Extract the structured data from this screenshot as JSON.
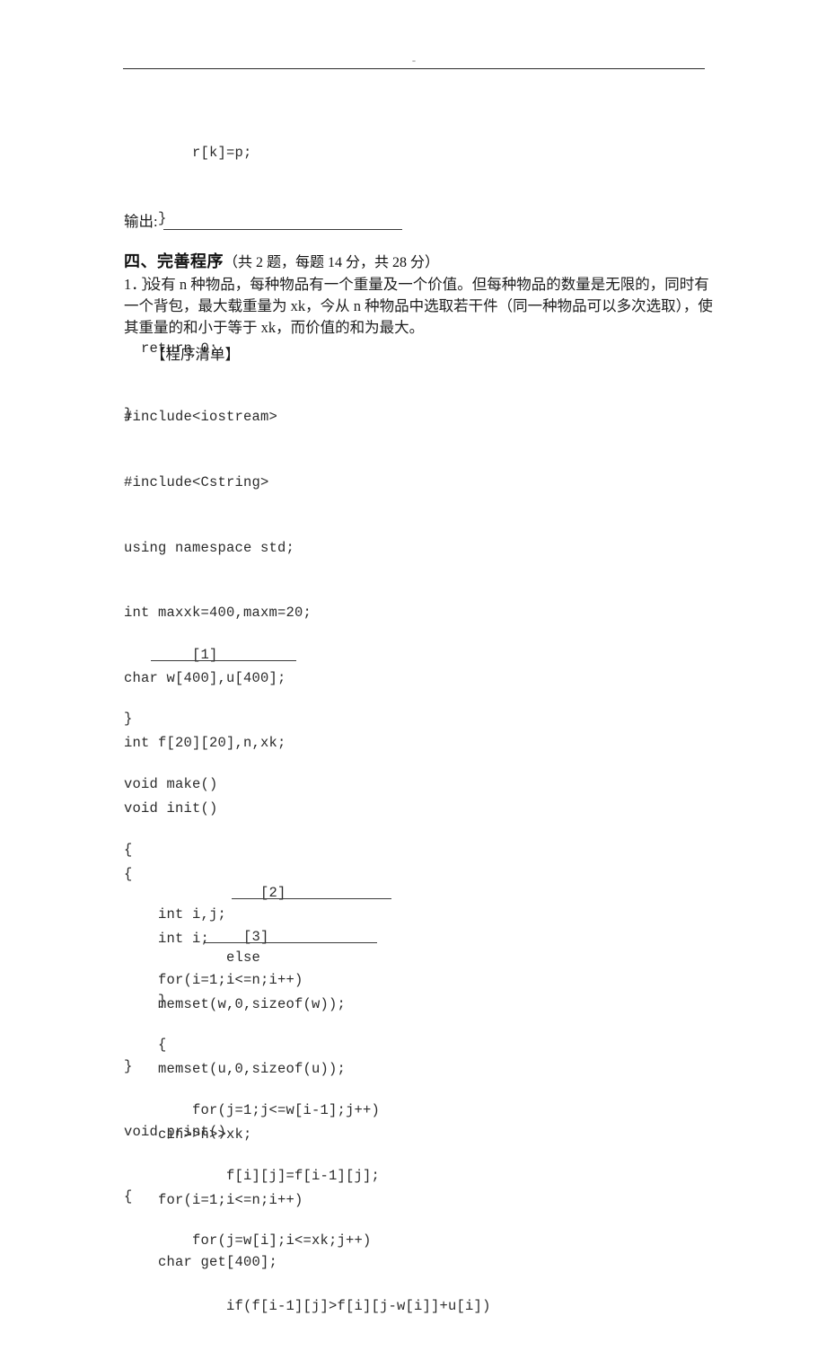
{
  "page": {
    "background": "#ffffff",
    "ink": "#2b2b2b",
    "header_mark": "-"
  },
  "code_top": {
    "lines": [
      "        r[k]=p;",
      "    }",
      "  }",
      "  return 0;",
      "}"
    ]
  },
  "output_line": {
    "label": "输出:"
  },
  "section": {
    "number_title": "四、完善程序",
    "paren": "（共 2 题，每题 14 分，共 28 分）"
  },
  "question": {
    "line1": "1．设有 n 种物品，每种物品有一个重量及一个价值。但每种物品的数量是无限的，同时有",
    "line2": "一个背包，最大载重量为 xk，今从 n 种物品中选取若干件（同一种物品可以多次选取），使",
    "line3": "其重量的和小于等于 xk，而价值的和为最大。"
  },
  "listing": {
    "title": "【程序清单】",
    "block1": [
      "#include<iostream>",
      "#include<Cstring>",
      "using namespace std;",
      "int maxxk=400,maxm=20;",
      "char w[400],u[400];",
      "int f[20][20],n,xk;",
      "void init()",
      "{",
      "    int i;",
      "    memset(w,0,sizeof(w));",
      "    memset(u,0,sizeof(u));",
      "    cin>>n>>xk;",
      "    for(i=1;i<=n;i++)"
    ],
    "blank1": "        [1]",
    "block2": [
      "}",
      "void make()",
      "{",
      "    int i,j;",
      "    for(i=1;i<=n;i++)",
      "    {",
      "        for(j=1;j<=w[i-1];j++)",
      "            f[i][j]=f[i-1][j];",
      "        for(j=w[i];i<=xk;j++)",
      "            if(f[i-1][j]>f[i][j-w[i]]+u[i])"
    ],
    "blank2": "                [2]",
    "block3": [
      "            else"
    ],
    "blank3": "              [3]",
    "block4": [
      "    }",
      "}",
      "void print()",
      "{",
      "    char get[400];"
    ]
  }
}
